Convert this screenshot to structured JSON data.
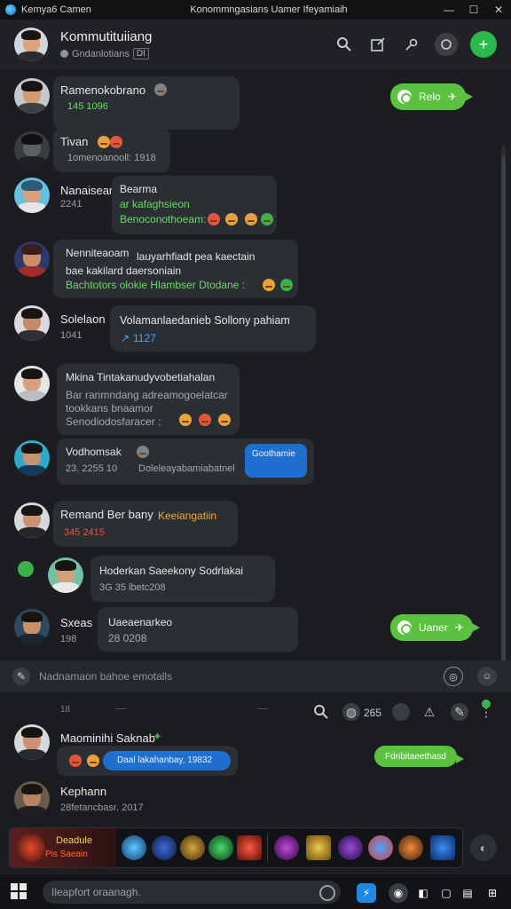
{
  "titlebar": {
    "app_name": "Kemya6 Camen",
    "window_title": "Konommngasians Uamer Ifeyamiaih",
    "minimize": "—",
    "maximize": "☐",
    "close": "✕"
  },
  "header": {
    "name": "Kommutituiiang",
    "subtitle": "Gndanlotians",
    "tag": "DI"
  },
  "messages": [
    {
      "sender": "Ramenokobrano",
      "meta": "145 1096"
    },
    {
      "sender": "Tivan",
      "meta": "1omenoanooll: 1918"
    },
    {
      "sender": "Nanaisean",
      "meta": "2241",
      "lines": [
        "Bearma",
        "ar kafaghsieon",
        "Benoconothoeam:"
      ]
    },
    {
      "sender": "Nenniteaoam",
      "lines": [
        "bae kakilard daersoniain",
        "Bachtotors olokie Hlambser Dtodane :"
      ],
      "header_line": "lauyarhfiadt pea kaectain"
    },
    {
      "sender": "Solelaon",
      "meta": "1041",
      "lines": [
        "Volamanlaedanieb Sollony pahiam",
        "1127"
      ]
    },
    {
      "sender": "Mkina Tintakanudyvobetiahalan",
      "lines": [
        "Bar ranmndang adreamogoelatcar",
        "tookkans bnaamor",
        "Senodiodosfaracer :"
      ]
    },
    {
      "sender": "Vodhomsak",
      "meta": "23. 2255 10",
      "lines": [
        "Doleleayabamiabatnel"
      ],
      "badge": "Goothamie"
    },
    {
      "sender": "Remand Ber bany",
      "highlight": "Keeiangatiin",
      "meta": "345 2415"
    },
    {
      "sender": "Hoderkan Saeekony Sodrlakai",
      "meta": "3G 35 lbetc208"
    },
    {
      "sender": "Sxeas",
      "meta": "198",
      "lines": [
        "Uaeaenarkeo",
        "28 0208"
      ]
    }
  ],
  "chips": {
    "top": "Relo",
    "bottom": "Uaner"
  },
  "composer": {
    "placeholder": "Nadnamaon bahoe emotalls"
  },
  "lower": {
    "label": "18",
    "count": "265",
    "messages": [
      {
        "sender": "Maominihi Saknab",
        "pill": "Daal lakahanbay, 19832"
      },
      {
        "sender": "Kephann",
        "meta": "28fetancbasr. 2017"
      }
    ],
    "green_pill": "Fdribitaeethasd"
  },
  "tray": {
    "promo_title": "Deadule",
    "promo_sub": "Pis Saeain"
  },
  "taskbar": {
    "search_placeholder": "Ileapfort oraanagh."
  },
  "colors": {
    "accent": "#5cc13f",
    "blue": "#1f6fd1",
    "bg": "#1b1d20"
  }
}
